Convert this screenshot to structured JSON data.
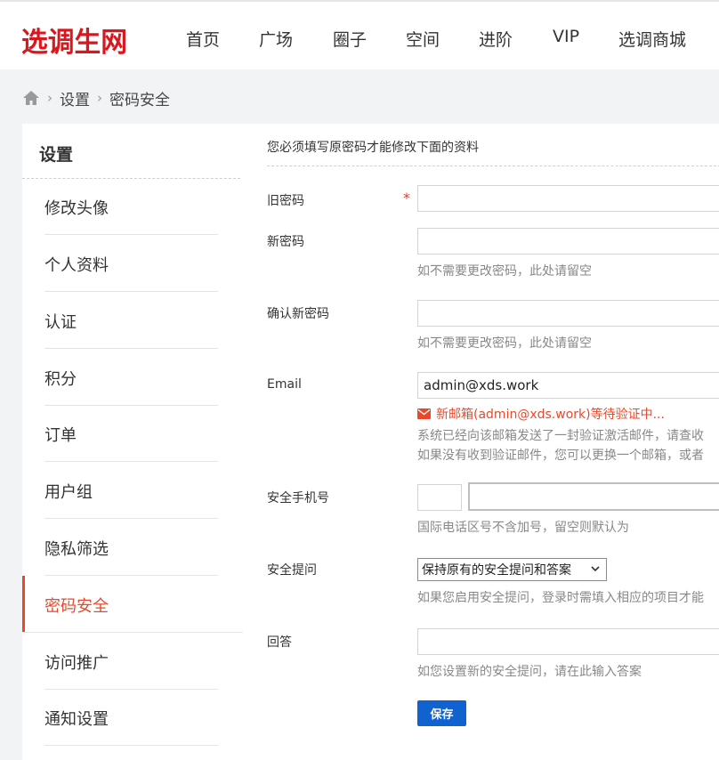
{
  "brand": {
    "logo_text": "选调生网",
    "logo_color": "#d9171e"
  },
  "nav": {
    "items": [
      {
        "label": "首页"
      },
      {
        "label": "广场"
      },
      {
        "label": "圈子"
      },
      {
        "label": "空间"
      },
      {
        "label": "进阶"
      },
      {
        "label": "VIP"
      },
      {
        "label": "选调商城"
      }
    ]
  },
  "breadcrumb": {
    "icon": "home-icon",
    "items": [
      "设置",
      "密码安全"
    ]
  },
  "sidebar": {
    "title": "设置",
    "active_color": "#e8492c",
    "items": [
      {
        "label": "修改头像"
      },
      {
        "label": "个人资料"
      },
      {
        "label": "认证"
      },
      {
        "label": "积分"
      },
      {
        "label": "订单"
      },
      {
        "label": "用户组"
      },
      {
        "label": "隐私筛选"
      },
      {
        "label": "密码安全",
        "active": true
      },
      {
        "label": "访问推广"
      },
      {
        "label": "通知设置"
      }
    ]
  },
  "form": {
    "notice": "您必须填写原密码才能修改下面的资料",
    "old_password": {
      "label": "旧密码",
      "required_mark": "*",
      "value": ""
    },
    "new_password": {
      "label": "新密码",
      "value": "",
      "hint": "如不需要更改密码，此处请留空"
    },
    "confirm_password": {
      "label": "确认新密码",
      "value": "",
      "hint": "如不需要更改密码，此处请留空"
    },
    "email": {
      "label": "Email",
      "value": "admin@xds.work",
      "pending_notice": "新邮箱(admin@xds.work)等待验证中...",
      "hint1": "系统已经向该邮箱发送了一封验证激活邮件，请查收",
      "hint2": "如果没有收到验证邮件，您可以更换一个邮箱，或者"
    },
    "phone": {
      "label": "安全手机号",
      "country_code": "",
      "value": "",
      "hint": "国际电话区号不含加号，留空则默认为"
    },
    "security_question": {
      "label": "安全提问",
      "selected": "保持原有的安全提问和答案",
      "hint": "如果您启用安全提问，登录时需填入相应的项目才能"
    },
    "answer": {
      "label": "回答",
      "value": "",
      "hint": "如您设置新的安全提问，请在此输入答案"
    },
    "save_label": "保存",
    "save_color": "#0f62cf"
  }
}
